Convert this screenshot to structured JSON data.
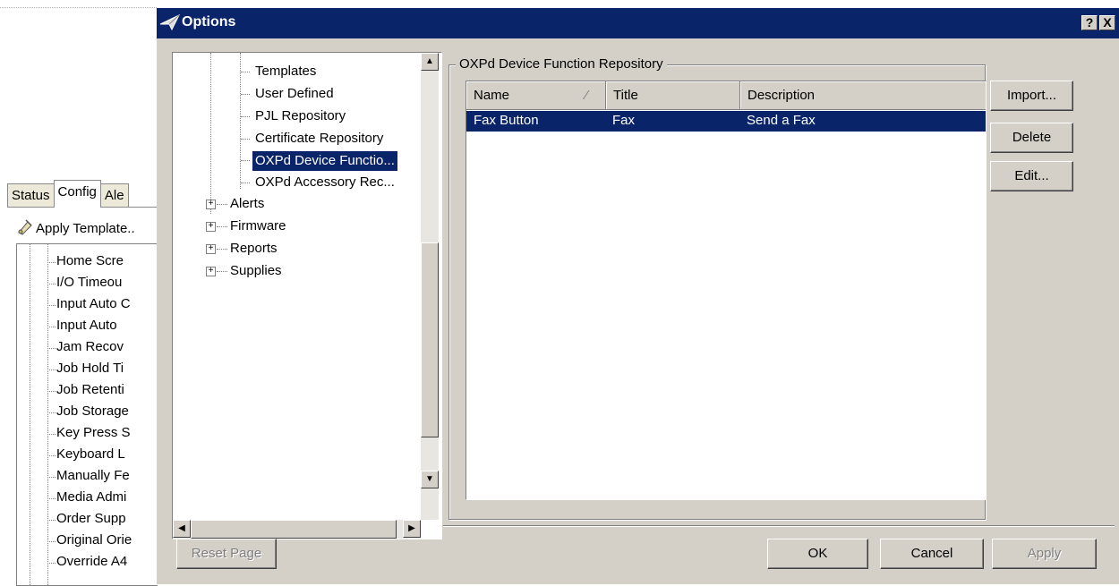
{
  "background_app": {
    "tabs": [
      "Status",
      "Config",
      "Ale"
    ],
    "active_tab": "Config",
    "apply_template": "Apply Template..",
    "tree_items": [
      "Home Scre",
      "I/O Timeou",
      "Input Auto C",
      "Input  Auto",
      "Jam Recov",
      "Job Hold Ti",
      "Job Retenti",
      "Job Storage",
      "Key Press S",
      "Keyboard L",
      "Manually Fe",
      "Media Admi",
      "Order Supp",
      "Original Orie",
      "Override A4"
    ]
  },
  "dialog": {
    "title": "Options",
    "help_btn": "?",
    "close_btn": "X",
    "tree": {
      "children": [
        "Templates",
        "User Defined",
        "PJL Repository",
        "Certificate Repository",
        "OXPd  Device  Functio...",
        "OXPd  Accessory  Rec..."
      ],
      "selected": "OXPd  Device  Functio...",
      "groups": [
        "Alerts",
        "Firmware",
        "Reports",
        "Supplies"
      ],
      "expander": "+",
      "scroll_up": "▲",
      "scroll_down": "▼",
      "scroll_left": "◀",
      "scroll_right": "▶"
    },
    "group_title": "OXPd Device Function Repository",
    "list": {
      "columns": [
        "Name",
        "Title",
        "Description"
      ],
      "sort_indicator": "⁄",
      "rows": [
        {
          "name": "Fax Button",
          "title": "Fax",
          "description": "Send a Fax"
        }
      ]
    },
    "side_buttons": {
      "import": "Import...",
      "delete": "Delete",
      "edit": "Edit..."
    },
    "footer": {
      "reset": "Reset Page",
      "ok": "OK",
      "cancel": "Cancel",
      "apply": "Apply"
    }
  }
}
